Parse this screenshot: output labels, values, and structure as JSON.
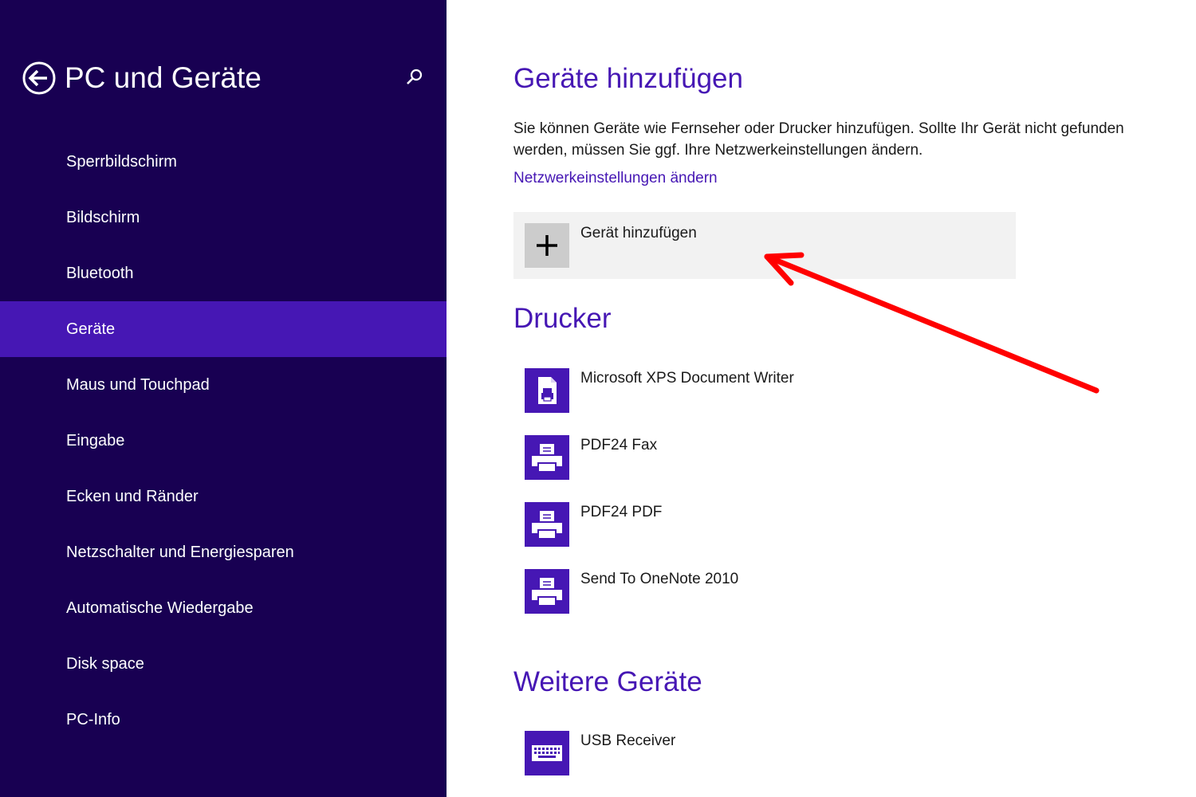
{
  "sidebar": {
    "title": "PC und Geräte",
    "items": [
      {
        "label": "Sperrbildschirm"
      },
      {
        "label": "Bildschirm"
      },
      {
        "label": "Bluetooth"
      },
      {
        "label": "Geräte",
        "selected": true
      },
      {
        "label": "Maus und Touchpad"
      },
      {
        "label": "Eingabe"
      },
      {
        "label": "Ecken und Ränder"
      },
      {
        "label": "Netzschalter und Energiesparen"
      },
      {
        "label": "Automatische Wiedergabe"
      },
      {
        "label": "Disk space"
      },
      {
        "label": "PC-Info"
      }
    ]
  },
  "main": {
    "add_section": {
      "heading": "Geräte hinzufügen",
      "description": "Sie können Geräte wie Fernseher oder Drucker hinzufügen. Sollte Ihr Gerät nicht gefunden werden, müssen Sie ggf. Ihre Netzwerkeinstellungen ändern.",
      "link": "Netzwerkeinstellungen ändern",
      "add_button": "Gerät hinzufügen"
    },
    "printers": {
      "heading": "Drucker",
      "items": [
        {
          "label": "Microsoft XPS Document Writer",
          "icon": "document-printer-icon"
        },
        {
          "label": "PDF24 Fax",
          "icon": "printer-icon"
        },
        {
          "label": "PDF24 PDF",
          "icon": "printer-icon"
        },
        {
          "label": "Send To OneNote 2010",
          "icon": "printer-icon"
        }
      ]
    },
    "other": {
      "heading": "Weitere Geräte",
      "items": [
        {
          "label": "USB Receiver",
          "icon": "keyboard-icon"
        }
      ]
    }
  },
  "colors": {
    "sidebar_bg": "#180052",
    "accent": "#4617b4",
    "annotation_arrow": "#ff0000"
  }
}
